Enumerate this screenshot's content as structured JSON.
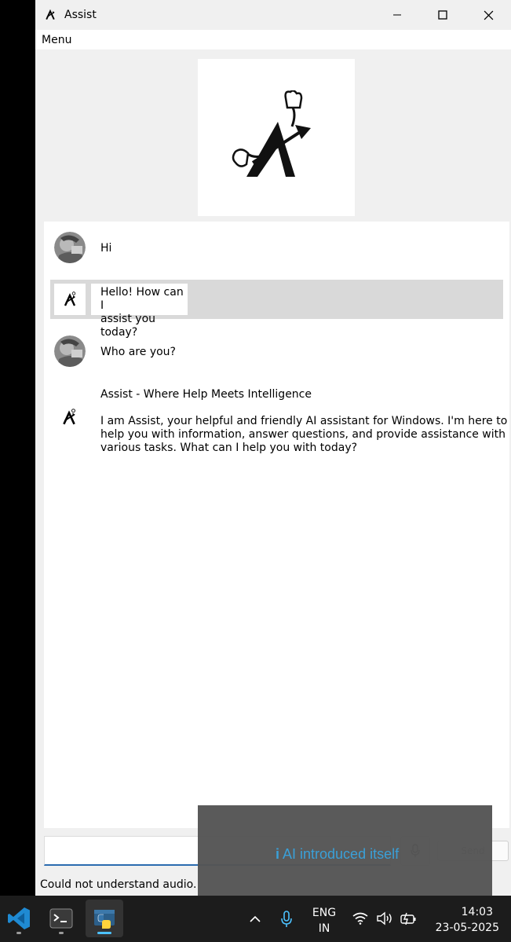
{
  "window": {
    "title": "Assist",
    "menu": [
      "Menu"
    ]
  },
  "chat": {
    "messages": [
      {
        "role": "user",
        "text": "Hi"
      },
      {
        "role": "assistant",
        "text_lines": [
          "Hello! How can I",
          "assist you today?"
        ]
      },
      {
        "role": "user",
        "text": "Who are you?"
      },
      {
        "role": "assistant",
        "heading": "Assist - Where Help Meets Intelligence",
        "body_lines": [
          "I am Assist, your helpful and friendly AI assistant for Windows. I'm here to",
          "help you with information, answer questions, and provide assistance with",
          "various tasks. What can I help you with today?"
        ]
      }
    ]
  },
  "input": {
    "value": "",
    "send_label": "Send"
  },
  "status": {
    "text": "Could not understand audio."
  },
  "toast": {
    "icon": "info-icon",
    "glyph": "i",
    "text": "AI introduced itself"
  },
  "taskbar": {
    "apps": [
      "vscode-icon",
      "terminal-icon",
      "python-icon"
    ],
    "language": [
      "ENG",
      "IN"
    ],
    "time": "14:03",
    "date": "23-05-2025"
  },
  "colors": {
    "accent": "#4cc2ff",
    "toast_text": "#3aa0d8",
    "highlight_row": "#d9d9d9"
  }
}
